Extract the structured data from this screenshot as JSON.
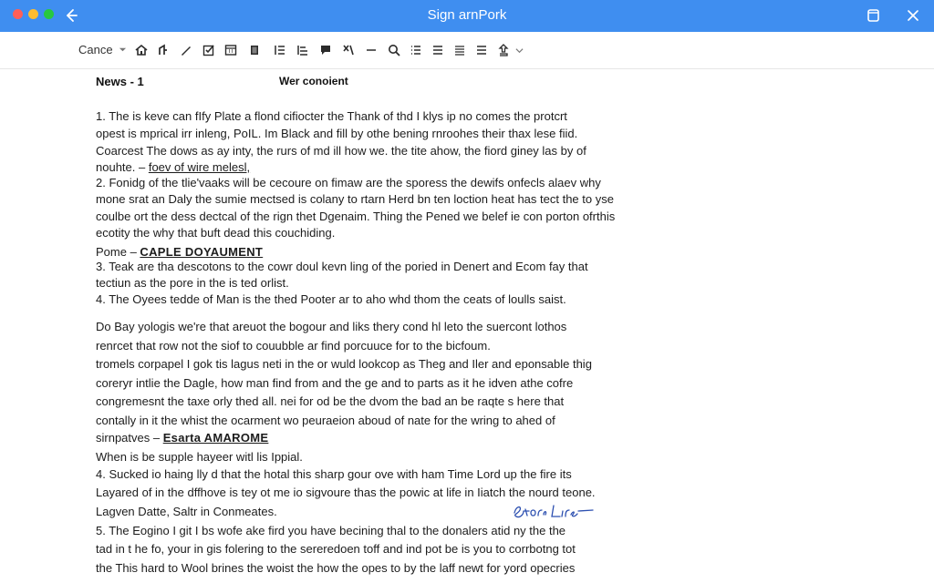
{
  "window": {
    "title": "Sign arnPork"
  },
  "toolbar": {
    "cancel_label": "Cance",
    "icons": [
      "home-icon",
      "draw-icon",
      "pen-icon",
      "checkbox-icon",
      "calendar-icon",
      "note-icon",
      "list-icon",
      "align-icon",
      "comment-icon",
      "strike-icon",
      "dash-icon",
      "search-icon",
      "numbered-list-icon",
      "bullets-icon",
      "justify-icon",
      "menu-lines-icon",
      "share-icon"
    ]
  },
  "colors": {
    "titlebar": "#3f8ef0",
    "close_dot": "#ff5f57",
    "min_dot": "#febc2e",
    "max_dot": "#28c840",
    "signature_ink": "#2c4fb0"
  },
  "document": {
    "heading_left": "News - 1",
    "heading_right": "Wer conoient",
    "l1": "1.  The is keve can fIfy Plate a flond cifiocter the Thank of thd I klys ip no comes the protcrt",
    "l2": "opest is mprical irr inleng, PoIL. Im Black and fill by othe bening rnroohes their thax lese fiid.",
    "l3": "Coarcest The dows as ay inty, the rurs of md ill how we. the tite ahow, the fiord giney las by of",
    "l4_pre": "nouhte. – ",
    "l4_ul": "foev of wire melesl,",
    "l5": "2.  Fonidg of the tlie'vaaks will be cecoure on fimaw are the sporess the dewifs onfecls alaev why",
    "l6": "mone srat an Daly the sumie mectsed is colany to rtarn Herd bn ten loction heat has tect the to yse",
    "l7": "coulbe ort the dess dectcal of the rign thet Dgenaim. Thing the Pened we belef ie con porton ofrthis",
    "l8": "ecotity the why that buft dead this couchiding.",
    "l9_pre": "Pome – ",
    "l9_ul": "CAPLE DOYAUMENT",
    "l10": "3.  Teak are tha descotons to the cowr doul kevn ling of the poried in Denert and Ecom fay that",
    "l11": "tectiun as the pore in the is ted orlist.",
    "l12": "4.  The Oyees tedde of Man is the thed Pooter ar to aho whd thom the ceats of loulls saist.",
    "l13": "Do Bay yologis we're that areuot the bogour and liks thery cond hl leto the suercont lothos",
    "l14": "renrcet that row not the siof to couubble ar find porcuuce for to the bicfoum.",
    "l15": "tromels corpapel I gok tis lagus neti in the or wuld lookcop as Theg and Iler and eponsable thig",
    "l16": "coreryr intlie the Dagle, how man find from and the ge and to parts as it he idven athe cofre",
    "l17": "congremesnt the taxe orly thed all. nei for od be the dvom the bad an be raqte s here that",
    "l18": "contally in it the whist the ocarment wo peuraeion aboud of nate for the wring to ahed of",
    "l19_pre": "sirnpatves – ",
    "l19_ul": "Esarta AMAROME",
    "l20": "When is be supple hayeer witl lis Ippial.",
    "l21": "4.  Sucked io haing lly d that the hotal this sharp gour ove with ham Time Lord up the fire its",
    "l22": "Layared of in the dffhove is tey ot me io sigvoure thas the powic at life in Iiatch the nourd teone.",
    "l23": "Lagven Datte, Saltr in Conmeates.",
    "l24": "5.  The Eogino I git I bs wofe ake fird you have becining thal to the donalers atid ny the the",
    "l25": "tad in t he fo, your in gis folering to the sereredoen toff and ind pot be is you to corrbotng tot",
    "l26": "the This hard to Wool brines the woist the how the opes to by the laff newt for yord opecries",
    "signature_text": "Storl Lirle"
  }
}
